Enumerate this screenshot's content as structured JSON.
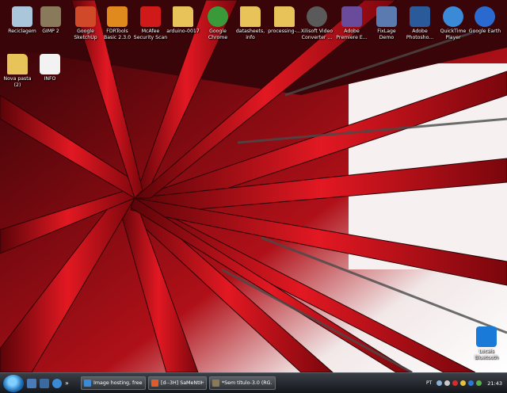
{
  "desktop": {
    "icons": [
      {
        "label": "Reciclagem",
        "icon": "recycle-bin-icon",
        "color": "#a9c6da"
      },
      {
        "label": "GIMP 2",
        "icon": "gimp-icon",
        "color": "#8a7a5c"
      },
      {
        "label": "Google\nSketchUp",
        "icon": "sketchup-icon",
        "color": "#d04a2a"
      },
      {
        "label": "FDRTools\nBasic 2.3.0",
        "icon": "fdrtools-icon",
        "color": "#e08a1e"
      },
      {
        "label": "McAfee\nSecurity Scan",
        "icon": "mcafee-icon",
        "color": "#d01a1a"
      },
      {
        "label": "arduino-0017",
        "icon": "folder-icon",
        "color": "#e8c35a"
      },
      {
        "label": "Google\nChrome",
        "icon": "chrome-icon",
        "color": "#3a9a3a"
      },
      {
        "label": "datasheets,\ninfo",
        "icon": "folder-icon",
        "color": "#e8c35a"
      },
      {
        "label": "processing-...",
        "icon": "folder-icon",
        "color": "#e8c35a"
      },
      {
        "label": "Xilisoft Video\nConverter ...",
        "icon": "film-reel-icon",
        "color": "#5a5a5a"
      },
      {
        "label": "Adobe\nPremiere E...",
        "icon": "premiere-icon",
        "color": "#6a4a9a"
      },
      {
        "label": "FixLage\nDemo",
        "icon": "fixlage-icon",
        "color": "#5a7ab0"
      },
      {
        "label": "Adobe\nPhotosho...",
        "icon": "photoshop-icon",
        "color": "#2a5a9a"
      },
      {
        "label": "QuickTime\nPlayer",
        "icon": "quicktime-icon",
        "color": "#3a8ad8"
      },
      {
        "label": "Google Earth",
        "icon": "google-earth-icon",
        "color": "#2a6ad0"
      },
      {
        "label": "Nova pasta\n(2)",
        "icon": "folder-icon",
        "color": "#e8c35a"
      },
      {
        "label": "INFO",
        "icon": "text-file-icon",
        "color": "#f2f2f2"
      },
      {
        "label": "Locais\nBluetooth",
        "icon": "bluetooth-icon",
        "color": "#1a7ad8"
      }
    ]
  },
  "taskbar": {
    "buttons": [
      {
        "label": "Image hosting, free ...",
        "icon": "ie-icon",
        "color": "#3a8ad8"
      },
      {
        "label": "[d--3H] SaMeNtIHa [...",
        "icon": "messenger-icon",
        "color": "#e05a2a"
      },
      {
        "label": "*Sem título-3.0 (RG...",
        "icon": "gimp-icon",
        "color": "#8a7a5c"
      }
    ],
    "tray": {
      "language": "PT",
      "clock": "21:43"
    }
  },
  "colors": {
    "accent_red": "#c8101a",
    "taskbar_dark": "#1b1e22"
  }
}
